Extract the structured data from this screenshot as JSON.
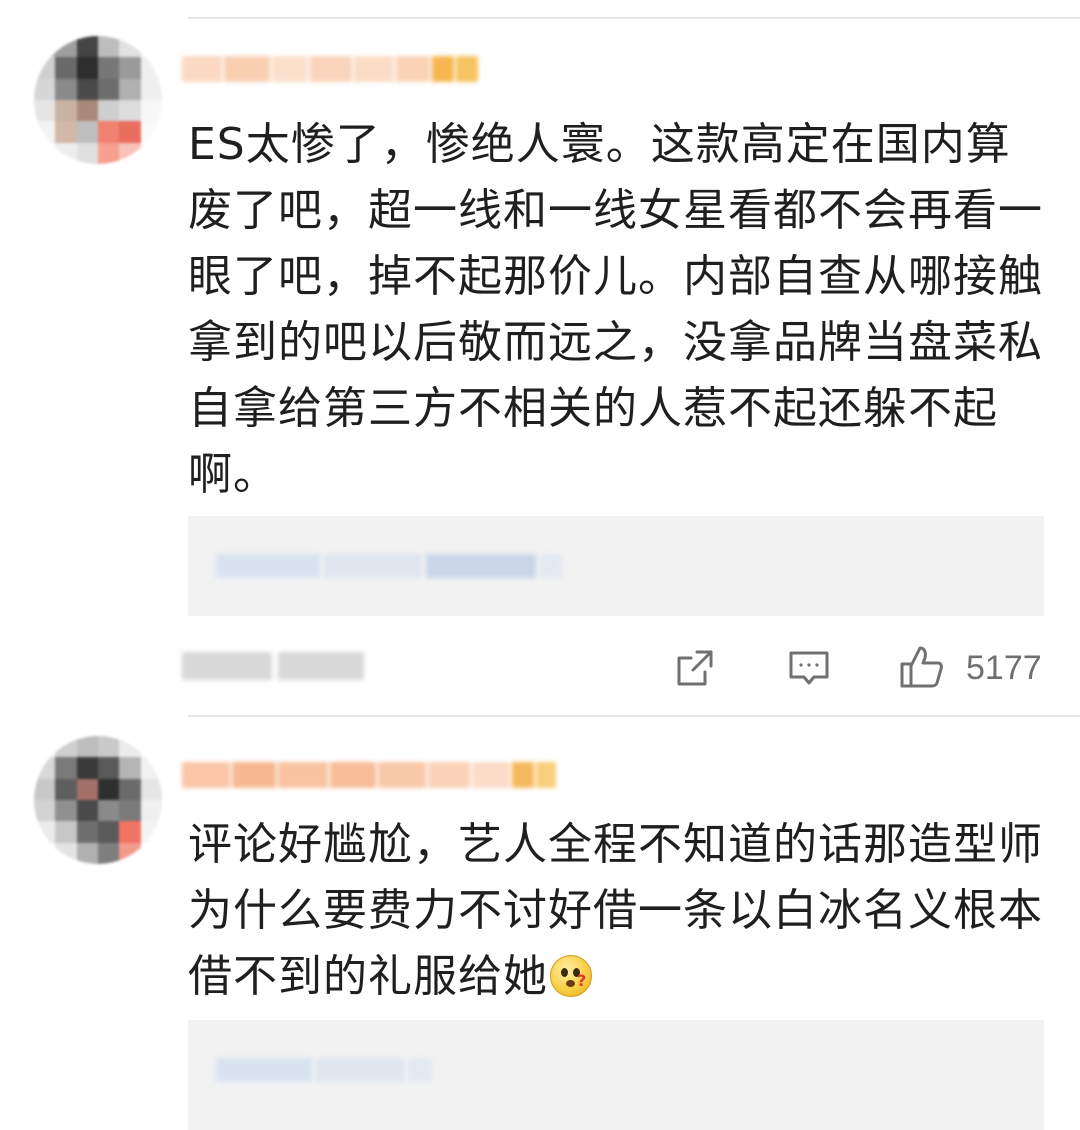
{
  "comments": [
    {
      "text": "ES太惨了，惨绝人寰。这款高定在国内算废了吧，超一线和一线女星看都不会再看一眼了吧，掉不起那价儿。内部自查从哪接触拿到的吧以后敬而远之，没拿品牌当盘菜私自拿给第三方不相关的人惹不起还躲不起啊。",
      "emoji": "",
      "likes": "5177",
      "actions": {
        "share_icon": "share-square-arrow-icon",
        "comment_icon": "comment-bubble-icon",
        "like_icon": "thumbs-up-icon"
      }
    },
    {
      "text": "评论好尴尬，艺人全程不知道的话那造型师为什么要费力不讨好借一条以白冰名义根本借不到的礼服给她",
      "emoji": "thinking-face-emoji"
    }
  ],
  "colors": {
    "text": "#1f1f1f",
    "meta": "#6f6f6f",
    "reply_bg": "#f2f2f2",
    "divider": "#e6e6e6"
  }
}
